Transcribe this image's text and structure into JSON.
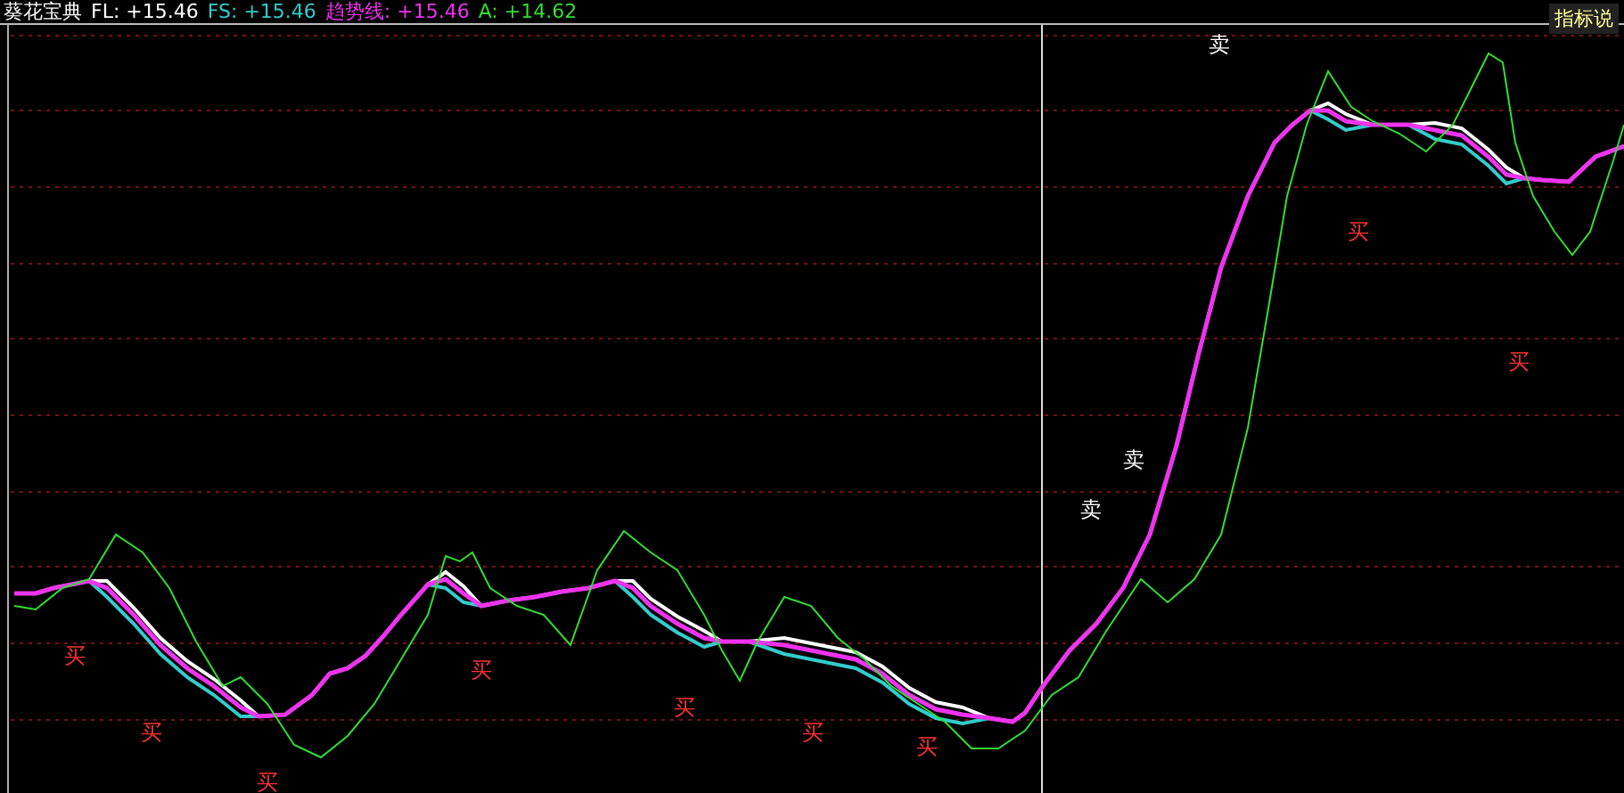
{
  "indicator": {
    "title": "葵花宝典",
    "legend": [
      {
        "text": "FL: +15.46",
        "color": "#ffffff"
      },
      {
        "text": "FS: +15.46",
        "color": "#33cccc"
      },
      {
        "text": "趋势线: +15.46",
        "color": "#ee33ee"
      },
      {
        "text": "A: +14.62",
        "color": "#33dd33"
      }
    ]
  },
  "help_button": {
    "label": "指标说"
  },
  "signals": [
    {
      "kind": "buy",
      "text": "买"
    },
    {
      "kind": "buy",
      "text": "买"
    },
    {
      "kind": "buy",
      "text": "买"
    },
    {
      "kind": "buy",
      "text": "买"
    },
    {
      "kind": "buy",
      "text": "买"
    },
    {
      "kind": "buy",
      "text": "买"
    },
    {
      "kind": "buy",
      "text": "买"
    },
    {
      "kind": "sell",
      "text": "卖"
    },
    {
      "kind": "sell",
      "text": "卖"
    },
    {
      "kind": "sell",
      "text": "卖"
    },
    {
      "kind": "buy",
      "text": "买"
    },
    {
      "kind": "buy",
      "text": "买"
    }
  ]
}
